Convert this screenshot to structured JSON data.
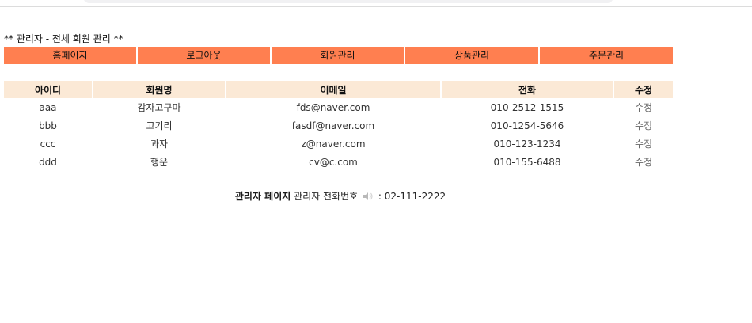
{
  "heading": "** 관리자 - 전체 회원 관리 **",
  "nav": [
    "홈페이지",
    "로그아웃",
    "회원관리",
    "상품관리",
    "주문관리"
  ],
  "table": {
    "headers": [
      "아이디",
      "회원명",
      "이메일",
      "전화",
      "수정"
    ],
    "rows": [
      [
        "aaa",
        "감자고구마",
        "fds@naver.com",
        "010-2512-1515",
        "수정"
      ],
      [
        "bbb",
        "고기리",
        "fasdf@naver.com",
        "010-1254-5646",
        "수정"
      ],
      [
        "ccc",
        "과자",
        "z@naver.com",
        "010-123-1234",
        "수정"
      ],
      [
        "ddd",
        "행운",
        "cv@c.com",
        "010-155-6488",
        "수정"
      ]
    ]
  },
  "footer": {
    "title": "관리자 페이지",
    "phone_label": "관리자 전화번호",
    "phone_icon": "speaker-icon",
    "phone_value": ": 02-111-2222"
  }
}
